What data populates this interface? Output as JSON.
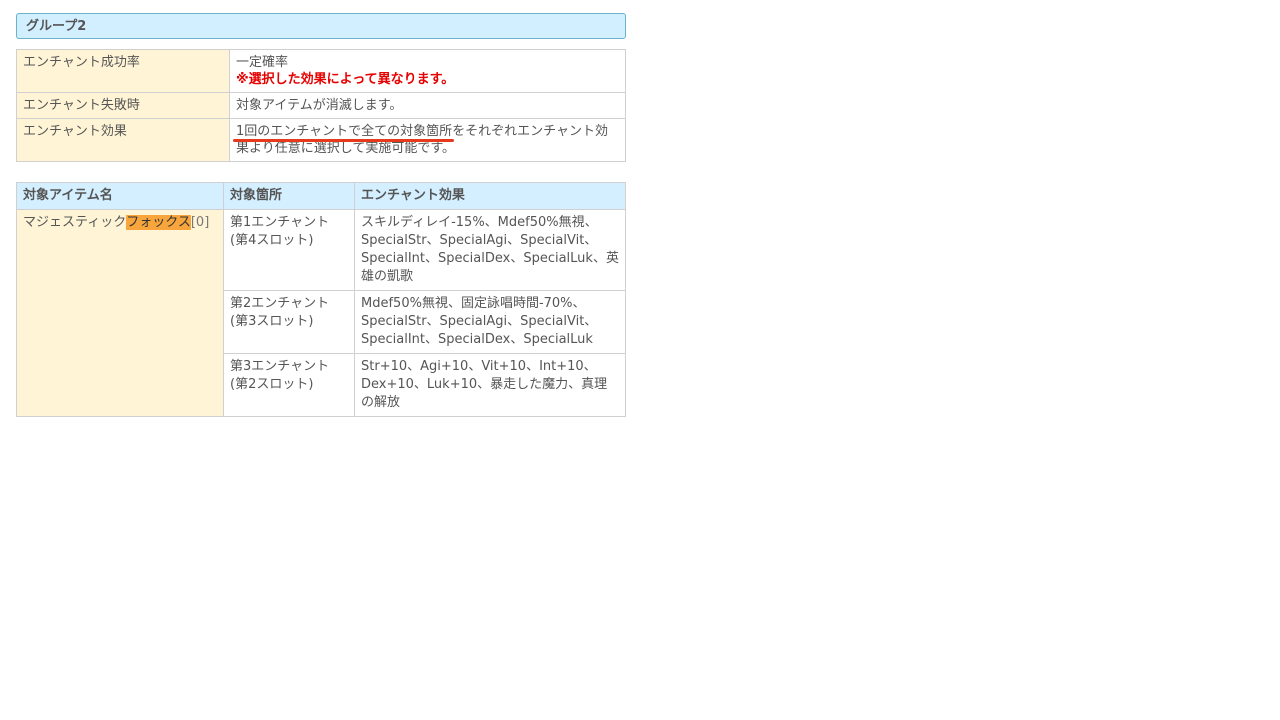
{
  "group_title": "グループ2",
  "info_rows": {
    "success_label": "エンチャント成功率",
    "success_value": "一定確率",
    "success_note": "※選択した効果によって異なります。",
    "fail_label": "エンチャント失敗時",
    "fail_value": "対象アイテムが消滅します。",
    "effect_label": "エンチャント効果",
    "effect_value_underlined": "1回のエンチャントで全ての対象箇所",
    "effect_value_rest": "をそれぞれエンチャント効果より任意に選択して実施可能です。"
  },
  "items_table": {
    "headers": [
      "対象アイテム名",
      "対象箇所",
      "エンチャント効果"
    ],
    "item_name_prefix": "マジェスティック",
    "item_name_highlight": "フォックス",
    "item_name_suffix": "[0]",
    "rows": [
      {
        "slot_line1": "第1エンチャント",
        "slot_line2": "(第4スロット)",
        "effect": "スキルディレイ-15%、Mdef50%無視、SpecialStr、SpecialAgi、SpecialVit、SpecialInt、SpecialDex、SpecialLuk、英雄の凱歌"
      },
      {
        "slot_line1": "第2エンチャント",
        "slot_line2": "(第3スロット)",
        "effect": "Mdef50%無視、固定詠唱時間-70%、SpecialStr、SpecialAgi、SpecialVit、SpecialInt、SpecialDex、SpecialLuk"
      },
      {
        "slot_line1": "第3エンチャント",
        "slot_line2": "(第2スロット)",
        "effect": "Str+10、Agi+10、Vit+10、Int+10、Dex+10、Luk+10、暴走した魔力、真理の解放"
      }
    ]
  },
  "colors": {
    "header_bg": "#d2efff",
    "label_bg": "#fff5d6",
    "note_red": "#e60000",
    "underline_red": "#e63a1e",
    "highlight_orange": "#f7a53c"
  }
}
